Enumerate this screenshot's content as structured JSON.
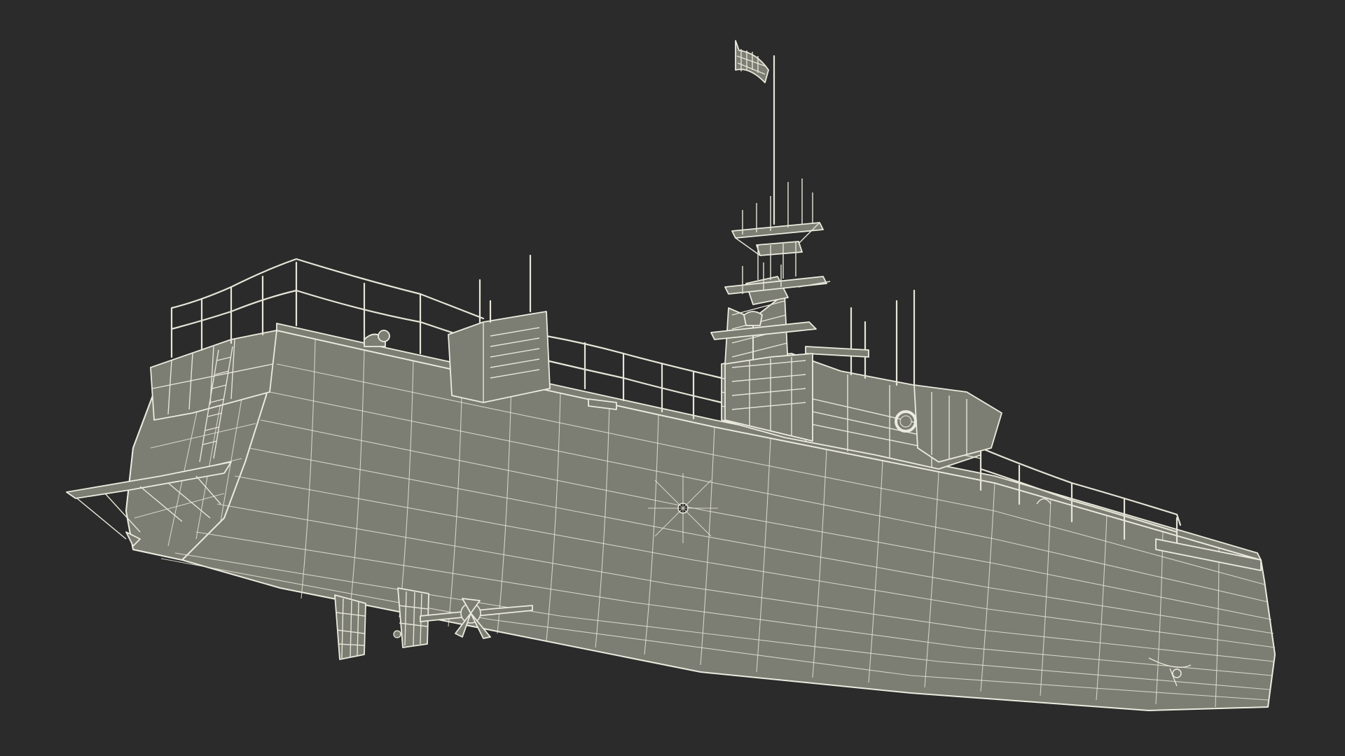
{
  "scene": {
    "subject": "wireframe-ship-model",
    "colors": {
      "background": "#2b2b2b",
      "surface": "#7c7d73",
      "wire": "#e3e2d4"
    }
  }
}
